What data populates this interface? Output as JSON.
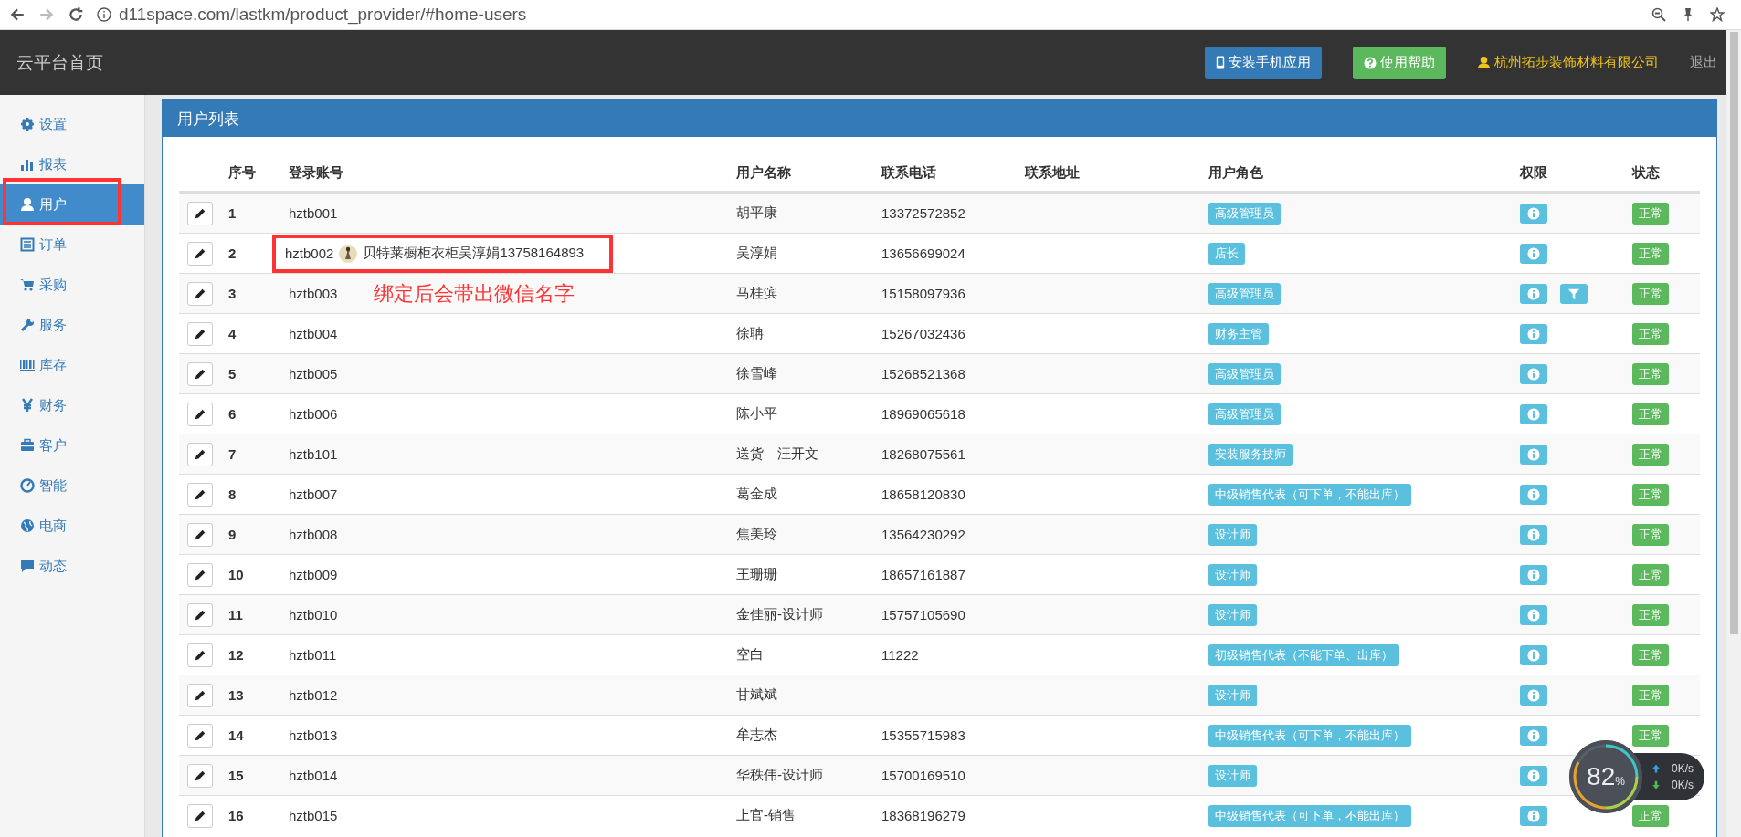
{
  "browser": {
    "url": "d11space.com/lastkm/product_provider/#home-users"
  },
  "header": {
    "title": "云平台首页",
    "buttons": [
      {
        "label": "安装手机应用",
        "kind": "app"
      },
      {
        "label": "使用帮助",
        "kind": "help"
      }
    ],
    "company": "杭州拓步装饰材料有限公司",
    "logout": "退出"
  },
  "sidebar": {
    "items": [
      {
        "label": "设置",
        "selected": false,
        "annotated": false
      },
      {
        "label": "报表",
        "selected": false,
        "annotated": false
      },
      {
        "label": "用户",
        "selected": true,
        "annotated": true
      },
      {
        "label": "订单",
        "selected": false,
        "annotated": false
      },
      {
        "label": "采购",
        "selected": false,
        "annotated": false
      },
      {
        "label": "服务",
        "selected": false,
        "annotated": false
      },
      {
        "label": "库存",
        "selected": false,
        "annotated": false
      },
      {
        "label": "财务",
        "selected": false,
        "annotated": false
      },
      {
        "label": "客户",
        "selected": false,
        "annotated": false
      },
      {
        "label": "智能",
        "selected": false,
        "annotated": false
      },
      {
        "label": "电商",
        "selected": false,
        "annotated": false
      },
      {
        "label": "动态",
        "selected": false,
        "annotated": false
      }
    ]
  },
  "panel": {
    "title": "用户列表"
  },
  "table": {
    "columns": [
      "序号",
      "登录账号",
      "用户名称",
      "联系电话",
      "联系地址",
      "用户角色",
      "权限",
      "状态"
    ],
    "rows": [
      {
        "no": "1",
        "account": "hztb001",
        "annotated": false,
        "name": "胡平康",
        "phone": "13372572852",
        "role": "高级管理员",
        "permissions": [
          {
            "kind": "info"
          }
        ],
        "status": "正常"
      },
      {
        "no": "2",
        "account": "hztb002",
        "wechat": {
          "kind": "picture",
          "name": "贝特莱橱柜衣柜吴淳娟13758164893"
        },
        "annotated": true,
        "name": "吴淳娟",
        "phone": "13656699024",
        "role": "店长",
        "permissions": [
          {
            "kind": "info"
          }
        ],
        "status": "正常"
      },
      {
        "no": "3",
        "account": "hztb003",
        "annotated": false,
        "note": "绑定后会带出微信名字",
        "name": "马桂滨",
        "phone": "15158097936",
        "role": "高级管理员",
        "permissions": [
          {
            "kind": "info"
          },
          {
            "kind": "filter"
          }
        ],
        "status": "正常"
      },
      {
        "no": "4",
        "account": "hztb004",
        "annotated": false,
        "name": "徐聃",
        "phone": "15267032436",
        "role": "财务主管",
        "permissions": [
          {
            "kind": "info"
          }
        ],
        "status": "正常"
      },
      {
        "no": "5",
        "account": "hztb005",
        "annotated": false,
        "name": "徐雪峰",
        "phone": "15268521368",
        "role": "高级管理员",
        "permissions": [
          {
            "kind": "info"
          }
        ],
        "status": "正常"
      },
      {
        "no": "6",
        "account": "hztb006",
        "annotated": false,
        "name": "陈小平",
        "phone": "18969065618",
        "role": "高级管理员",
        "permissions": [
          {
            "kind": "info"
          }
        ],
        "status": "正常"
      },
      {
        "no": "7",
        "account": "hztb101",
        "annotated": false,
        "name": "送货—汪开文",
        "phone": "18268075561",
        "role": "安装服务技师",
        "permissions": [
          {
            "kind": "info"
          }
        ],
        "status": "正常"
      },
      {
        "no": "8",
        "account": "hztb007",
        "annotated": false,
        "name": "葛金成",
        "phone": "18658120830",
        "role": "中级销售代表（可下单，不能出库）",
        "permissions": [
          {
            "kind": "info"
          }
        ],
        "status": "正常"
      },
      {
        "no": "9",
        "account": "hztb008",
        "annotated": false,
        "name": "焦美玲",
        "phone": "13564230292",
        "role": "设计师",
        "permissions": [
          {
            "kind": "info"
          }
        ],
        "status": "正常"
      },
      {
        "no": "10",
        "account": "hztb009",
        "annotated": false,
        "name": "王珊珊",
        "phone": "18657161887",
        "role": "设计师",
        "permissions": [
          {
            "kind": "info"
          }
        ],
        "status": "正常"
      },
      {
        "no": "11",
        "account": "hztb010",
        "annotated": false,
        "name": "金佳丽-设计师",
        "phone": "15757105690",
        "role": "设计师",
        "permissions": [
          {
            "kind": "info"
          }
        ],
        "status": "正常"
      },
      {
        "no": "12",
        "account": "hztb011",
        "annotated": false,
        "name": "空白",
        "phone": "11222",
        "role": "初级销售代表（不能下单、出库）",
        "permissions": [
          {
            "kind": "info"
          }
        ],
        "status": "正常"
      },
      {
        "no": "13",
        "account": "hztb012",
        "annotated": false,
        "name": "甘斌斌",
        "role": "设计师",
        "permissions": [
          {
            "kind": "info"
          }
        ],
        "status": "正常"
      },
      {
        "no": "14",
        "account": "hztb013",
        "annotated": false,
        "name": "牟志杰",
        "phone": "15355715983",
        "role": "中级销售代表（可下单，不能出库）",
        "permissions": [
          {
            "kind": "info"
          }
        ],
        "status": "正常"
      },
      {
        "no": "15",
        "account": "hztb014",
        "annotated": false,
        "name": "华秩伟-设计师",
        "phone": "15700169510",
        "role": "设计师",
        "permissions": [
          {
            "kind": "info"
          }
        ]
      },
      {
        "no": "16",
        "account": "hztb015",
        "annotated": false,
        "name": "上官-销售",
        "phone": "18368196279",
        "role": "中级销售代表（可下单，不能出库）",
        "permissions": [
          {
            "kind": "info"
          }
        ],
        "status": "正常"
      }
    ]
  },
  "speed_widget": {
    "percent": "82",
    "unit": "%",
    "upload": "0K/s",
    "download": "0K/s"
  }
}
